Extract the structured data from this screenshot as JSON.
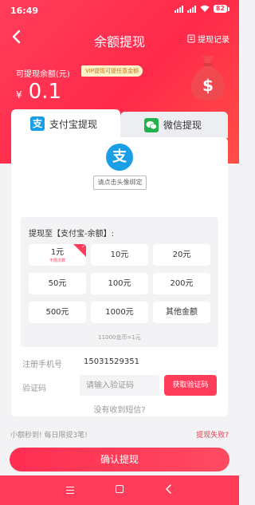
{
  "status_bar": {
    "time": "16:49",
    "battery": "82"
  },
  "nav": {
    "title": "余额提现",
    "record_label": "提现记录"
  },
  "balance": {
    "label": "可提现余额(元)",
    "vip_tag": "VIP提现可提任意金额",
    "currency": "¥",
    "value": "0.1"
  },
  "tabs": [
    {
      "label": "支付宝提现",
      "icon": "alipay-icon",
      "active": true
    },
    {
      "label": "微信提现",
      "icon": "wechat-icon",
      "active": false
    }
  ],
  "alipay": {
    "icon_char": "支",
    "bind_label": "请点击头像绑定"
  },
  "amount": {
    "title": "提现至【支付宝-余额】:",
    "options": [
      {
        "label": "1元",
        "sub": "不限次数",
        "selected": true
      },
      {
        "label": "10元"
      },
      {
        "label": "20元"
      },
      {
        "label": "50元"
      },
      {
        "label": "100元"
      },
      {
        "label": "200元"
      },
      {
        "label": "500元"
      },
      {
        "label": "1000元"
      },
      {
        "label": "其他金额"
      }
    ],
    "rate": "11000金币=1元"
  },
  "form": {
    "phone_label": "注册手机号",
    "phone_value": "15031529351",
    "code_label": "验证码",
    "code_placeholder": "请输入验证码",
    "code_button": "获取验证码",
    "no_sms": "没有收到短信?"
  },
  "footer": {
    "note_left": "小额秒到! 每日限提3笔!",
    "note_right": "提现失败?",
    "confirm_label": "确认提现"
  },
  "colors": {
    "accent": "#ff3d5a",
    "alipay": "#1a9fe6",
    "wechat": "#22b14c"
  }
}
